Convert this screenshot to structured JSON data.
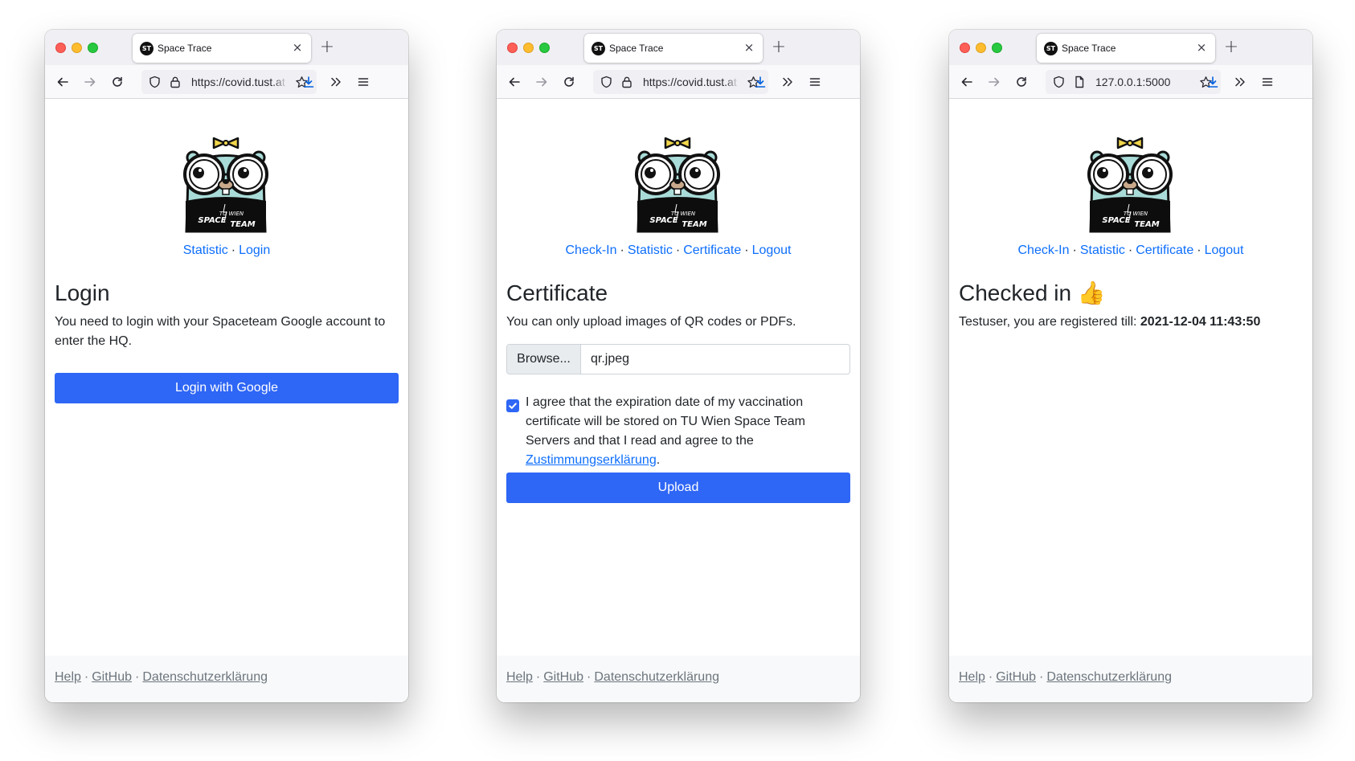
{
  "browser": {
    "tab_title": "Space Trace",
    "favicon_text": "ST",
    "close_symbol": "×",
    "newtab_symbol": "+"
  },
  "logo": {
    "line1": "TU WIEN",
    "line2": "SPACE",
    "line3": "TEAM"
  },
  "windows": [
    {
      "url": "https://covid.tust.at",
      "nav": [
        "Statistic",
        "Login"
      ],
      "title": "Login",
      "text": "You need to login with your Spaceteam Google account to enter the HQ.",
      "button": "Login with Google"
    },
    {
      "url": "https://covid.tust.at",
      "nav": [
        "Check-In",
        "Statistic",
        "Certificate",
        "Logout"
      ],
      "title": "Certificate",
      "text": "You can only upload images of QR codes or PDFs.",
      "browse_label": "Browse...",
      "file_name": "qr.jpeg",
      "checkbox_text": "I agree that the expiration date of my vaccination certificate will be stored on TU Wien Space Team Servers and that I read and agree to the",
      "checkbox_link": "Zustimmungserklärung",
      "checkbox_end": ".",
      "checkbox_checked": true,
      "button": "Upload"
    },
    {
      "url": "127.0.0.1:5000",
      "nav": [
        "Check-In",
        "Statistic",
        "Certificate",
        "Logout"
      ],
      "title": "Checked in",
      "title_emoji": "👍",
      "text_prefix": "Testuser, you are registered till: ",
      "text_date": "2021-12-04 11:43:50"
    }
  ],
  "footer": {
    "help": "Help",
    "github": "GitHub",
    "privacy": "Datenschutzerklärung",
    "sep": "·"
  },
  "nav_sep": "·",
  "colors": {
    "primary": "#2e66f5",
    "link": "#0d6efd",
    "footer_bg": "#f8f9fa"
  }
}
